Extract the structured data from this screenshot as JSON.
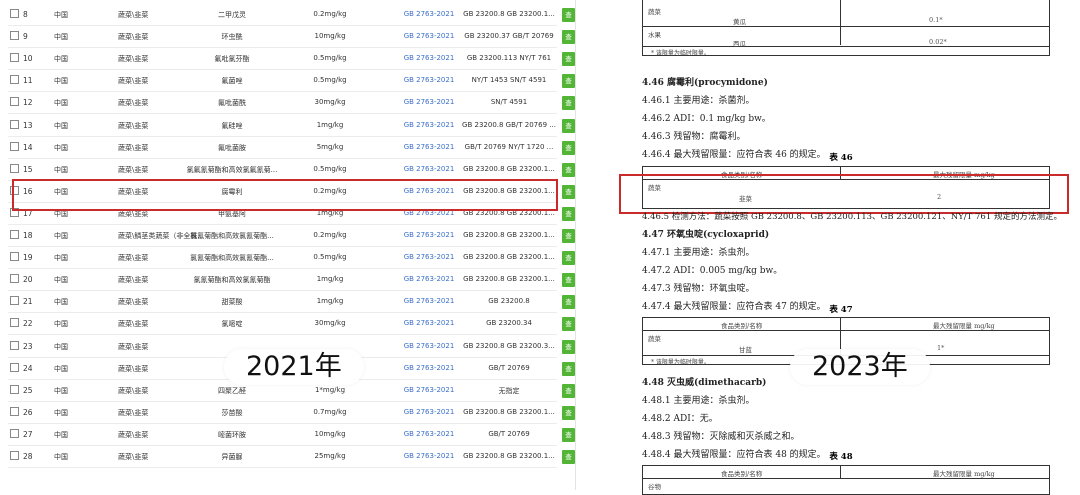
{
  "left_table": {
    "rows": [
      {
        "no": "8",
        "country": "中国",
        "category": "蔬菜\\韭菜",
        "pesticide": "二甲戊灵",
        "limit": "0.2mg/kg",
        "standard": "GB 2763-2021",
        "method": "GB 23200.8 GB 23200.1...",
        "action": "查"
      },
      {
        "no": "9",
        "country": "中国",
        "category": "蔬菜\\韭菜",
        "pesticide": "环虫酰",
        "limit": "10mg/kg",
        "standard": "GB 2763-2021",
        "method": "GB 23200.37 GB/T 20769",
        "action": "查"
      },
      {
        "no": "10",
        "country": "中国",
        "category": "蔬菜\\韭菜",
        "pesticide": "氟吡氯芬酯",
        "limit": "0.5mg/kg",
        "standard": "GB 2763-2021",
        "method": "GB 23200.113 NY/T 761",
        "action": "查"
      },
      {
        "no": "11",
        "country": "中国",
        "category": "蔬菜\\韭菜",
        "pesticide": "氟菌唑",
        "limit": "0.5mg/kg",
        "standard": "GB 2763-2021",
        "method": "NY/T 1453 SN/T 4591",
        "action": "查"
      },
      {
        "no": "12",
        "country": "中国",
        "category": "蔬菜\\韭菜",
        "pesticide": "氟吡菌酰",
        "limit": "30mg/kg",
        "standard": "GB 2763-2021",
        "method": "SN/T 4591",
        "action": "查"
      },
      {
        "no": "13",
        "country": "中国",
        "category": "蔬菜\\韭菜",
        "pesticide": "氟硅唑",
        "limit": "1mg/kg",
        "standard": "GB 2763-2021",
        "method": "GB 23200.8 GB/T 20769 ...",
        "action": "查"
      },
      {
        "no": "14",
        "country": "中国",
        "category": "蔬菜\\韭菜",
        "pesticide": "氟吡菌胺",
        "limit": "5mg/kg",
        "standard": "GB 2763-2021",
        "method": "GB/T 20769 NY/T 1720 ...",
        "action": "查"
      },
      {
        "no": "15",
        "country": "中国",
        "category": "蔬菜\\韭菜",
        "pesticide": "氯氟氰菊酯和高效氯氟氰菊...",
        "limit": "0.5mg/kg",
        "standard": "GB 2763-2021",
        "method": "GB 23200.8 GB 23200.1...",
        "action": "查"
      },
      {
        "no": "16",
        "country": "中国",
        "category": "蔬菜\\韭菜",
        "pesticide": "腐霉利",
        "limit": "0.2mg/kg",
        "standard": "GB 2763-2021",
        "method": "GB 23200.8 GB 23200.1...",
        "action": "查"
      },
      {
        "no": "17",
        "country": "中国",
        "category": "蔬菜\\韭菜",
        "pesticide": "甲氨基阿",
        "limit": "1mg/kg",
        "standard": "GB 2763-2021",
        "method": "GB 23200.8 GB 23200.1...",
        "action": "查"
      },
      {
        "no": "18",
        "country": "中国",
        "category": "蔬菜\\鳞茎类蔬菜（非全株...",
        "pesticide": "氯氰菊酯和高效氯氰菊酯...",
        "limit": "0.2mg/kg",
        "standard": "GB 2763-2021",
        "method": "GB 23200.8 GB 23200.1...",
        "action": "查"
      },
      {
        "no": "19",
        "country": "中国",
        "category": "蔬菜\\韭菜",
        "pesticide": "氯氰菊酯和高效氯氰菊酯...",
        "limit": "0.5mg/kg",
        "standard": "GB 2763-2021",
        "method": "GB 23200.8 GB 23200.1...",
        "action": "查"
      },
      {
        "no": "20",
        "country": "中国",
        "category": "蔬菜\\韭菜",
        "pesticide": "氯氰菊酯和高效氯氰菊酯",
        "limit": "1mg/kg",
        "standard": "GB 2763-2021",
        "method": "GB 23200.8 GB 23200.1...",
        "action": "查"
      },
      {
        "no": "21",
        "country": "中国",
        "category": "蔬菜\\韭菜",
        "pesticide": "甜菜酸",
        "limit": "1mg/kg",
        "standard": "GB 2763-2021",
        "method": "GB 23200.8",
        "action": "查"
      },
      {
        "no": "22",
        "country": "中国",
        "category": "蔬菜\\韭菜",
        "pesticide": "氯嘧啶",
        "limit": "30mg/kg",
        "standard": "GB 2763-2021",
        "method": "GB 23200.34",
        "action": "查"
      },
      {
        "no": "23",
        "country": "中国",
        "category": "蔬菜\\韭菜",
        "pesticide": "",
        "limit": "",
        "standard": "GB 2763-2021",
        "method": "GB 23200.8 GB 23200.3...",
        "action": "查"
      },
      {
        "no": "24",
        "country": "中国",
        "category": "蔬菜\\韭菜",
        "pesticide": "",
        "limit": "",
        "standard": "GB 2763-2021",
        "method": "GB/T 20769",
        "action": "查"
      },
      {
        "no": "25",
        "country": "中国",
        "category": "蔬菜\\韭菜",
        "pesticide": "四聚乙醛",
        "limit": "1*mg/kg",
        "standard": "GB 2763-2021",
        "method": "无指定",
        "action": "查"
      },
      {
        "no": "26",
        "country": "中国",
        "category": "蔬菜\\韭菜",
        "pesticide": "莎苗酸",
        "limit": "0.7mg/kg",
        "standard": "GB 2763-2021",
        "method": "GB 23200.8 GB 23200.1...",
        "action": "查"
      },
      {
        "no": "27",
        "country": "中国",
        "category": "蔬菜\\韭菜",
        "pesticide": "嘧菌环胺",
        "limit": "10mg/kg",
        "standard": "GB 2763-2021",
        "method": "GB/T 20769",
        "action": "查"
      },
      {
        "no": "28",
        "country": "中国",
        "category": "蔬菜\\韭菜",
        "pesticide": "异菌脲",
        "limit": "25mg/kg",
        "standard": "GB 2763-2021",
        "method": "GB 23200.8 GB 23200.1...",
        "action": "查"
      }
    ]
  },
  "labels": {
    "left_year": "2021年",
    "right_year": "2023年"
  },
  "doc": {
    "top_table": {
      "r1_cat": "蔬菜",
      "r1_food": "黄瓜",
      "r1_val": "0.1*",
      "r2_cat": "水果",
      "r2_food": "西瓜",
      "r2_val": "0.02*",
      "note": "* 该限量为临时限量。"
    },
    "sec46": {
      "heading": "4.46  腐霉利(procymidone)",
      "l1": "4.46.1  主要用途：杀菌剂。",
      "l2": "4.46.2  ADI：0.1 mg/kg bw。",
      "l3": "4.46.3  残留物：腐霉利。",
      "l4": "4.46.4  最大残留限量：应符合表 46 的规定。",
      "table_title": "表 46",
      "th1": "食品类别/名称",
      "th2": "最大残留限量 mg/kg",
      "cat": "蔬菜",
      "food": "韭菜",
      "val": "2",
      "l5": "4.46.5  检测方法：蔬菜按照 GB 23200.8、GB 23200.113、GB 23200.121、NY/T 761 规定的方法测定。"
    },
    "sec47": {
      "heading": "4.47  环氧虫啶(cycloxaprid)",
      "l1": "4.47.1  主要用途：杀虫剂。",
      "l2": "4.47.2  ADI：0.005 mg/kg bw。",
      "l3": "4.47.3  残留物：环氧虫啶。",
      "l4": "4.47.4  最大残留限量：应符合表 47 的规定。",
      "table_title": "表 47",
      "th1": "食品类别/名称",
      "th2": "最大残留限量 mg/kg",
      "cat": "蔬菜",
      "food": "甘蓝",
      "val": "1*",
      "note": "* 该限量为临时限量。"
    },
    "sec48": {
      "heading": "4.48  灭虫威(dimethacarb)",
      "l1": "4.48.1  主要用途：杀虫剂。",
      "l2": "4.48.2  ADI：无。",
      "l3": "4.48.3  残留物：灭除威和灭杀威之和。",
      "l4": "4.48.4  最大残留限量：应符合表 48 的规定。",
      "table_title": "表 48",
      "th1": "食品类别/名称",
      "th2": "最大残留限量 mg/kg",
      "cat": "谷物"
    }
  },
  "colors": {
    "accent_green": "#52b536",
    "highlight_red": "#c92b2b",
    "link_blue": "#3b6fc9"
  }
}
